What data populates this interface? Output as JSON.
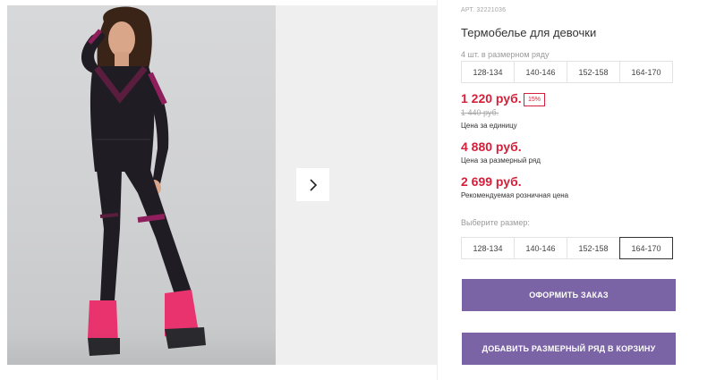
{
  "product": {
    "article": "АРТ. 32221036",
    "title": "Термобелье для девочки",
    "pack_hint": "4 шт. в размерном ряду",
    "size_range": [
      "128-134",
      "140-146",
      "152-158",
      "164-170"
    ],
    "price": "1 220 руб.",
    "discount": "15%",
    "old_price": "1 440 руб.",
    "price_note": "Цена за единицу",
    "range_price": "4 880 руб.",
    "range_price_note": "Цена за размерный ряд",
    "retail_price": "2 699 руб.",
    "retail_price_note": "Рекомендуемая розничная цена",
    "select_label": "Выберите размер:",
    "size_options": [
      "128-134",
      "140-146",
      "152-158",
      "164-170"
    ],
    "selected_size": "164-170"
  },
  "actions": {
    "order": "ОФОРМИТЬ ЗАКАЗ",
    "add_range": "ДОБАВИТЬ РАЗМЕРНЫЙ РЯД В КОРЗИНУ"
  },
  "gallery": {
    "next_icon": "chevron-right-icon"
  },
  "colors": {
    "accent_red": "#d61f3a",
    "button_purple": "#7b64a6",
    "garment_black": "#1c1a20",
    "garment_magenta": "#8e1f5c",
    "boot_pink": "#e8336f"
  }
}
